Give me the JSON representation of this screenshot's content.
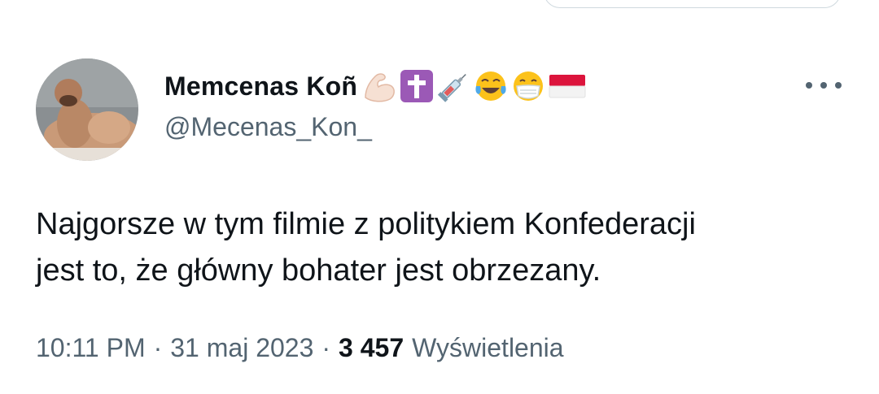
{
  "author": {
    "display_name": "Memcenas Koñ",
    "handle": "@Mecenas_Kon_",
    "name_emojis": [
      "flexed-biceps",
      "latin-cross",
      "syringe",
      "tears-of-joy",
      "face-with-medical-mask",
      "flag-poland-inverted"
    ]
  },
  "tweet": {
    "lines": [
      "Najgorsze w tym filmie z politykiem Konfederacji",
      "jest to, że główny bohater jest obrzezany."
    ],
    "time": "10:11 PM",
    "separator": "·",
    "date": "31 maj 2023",
    "views_count": "3 457",
    "views_label": "Wyświetlenia"
  },
  "colors": {
    "text_primary": "#0f1419",
    "text_secondary": "#536471",
    "cross_badge": "#9b59b6",
    "flag_red": "#dc143c"
  }
}
